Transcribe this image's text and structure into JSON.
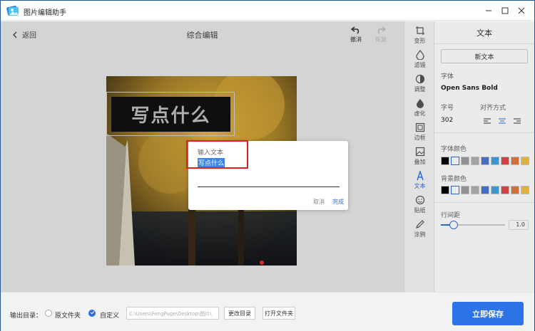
{
  "app": {
    "title": "图片编辑助手"
  },
  "header": {
    "back_label": "返回",
    "page_title": "综合编辑",
    "undo_label": "撤消",
    "redo_label": "恢复"
  },
  "canvas": {
    "overlay_text": "写点什么"
  },
  "dialog": {
    "title": "输入文本",
    "value": "写点什么",
    "cancel_label": "取消",
    "done_label": "完成"
  },
  "toolbar": {
    "items": [
      {
        "label": "变形",
        "icon": "crop-icon"
      },
      {
        "label": "滤镜",
        "icon": "filter-icon"
      },
      {
        "label": "调整",
        "icon": "adjust-icon"
      },
      {
        "label": "虚化",
        "icon": "blur-icon"
      },
      {
        "label": "边框",
        "icon": "frame-icon"
      },
      {
        "label": "叠加",
        "icon": "overlay-icon"
      },
      {
        "label": "文本",
        "icon": "text-icon"
      },
      {
        "label": "贴纸",
        "icon": "sticker-icon"
      },
      {
        "label": "涂鸦",
        "icon": "doodle-icon"
      }
    ],
    "active": "文本"
  },
  "panel": {
    "title": "文本",
    "new_text_label": "新文本",
    "font_label": "字体",
    "font_value": "Open Sans Bold",
    "size_label": "字号",
    "size_value": "302",
    "align_label": "对齐方式",
    "font_color_label": "字体颜色",
    "bg_color_label": "背景颜色",
    "line_spacing_label": "行间距",
    "line_spacing_value": "1.0",
    "line_spacing_level": 0.1,
    "font_colors": [
      "#000000",
      "#ffffff",
      "#9e9e9e",
      "#b0b0b0",
      "#4a78d6",
      "#3fa3e0",
      "#e04848",
      "#e07a3f",
      "#f0c040"
    ],
    "bg_colors": [
      "#000000",
      "#ffffff",
      "#9e9e9e",
      "#b0b0b0",
      "#4a78d6",
      "#3fa3e0",
      "#e04848",
      "#e07a3f",
      "#f0c040"
    ]
  },
  "bottom": {
    "output_label": "输出目录：",
    "option_original": "原文件夹",
    "option_custom": "自定义",
    "path_value": "C:\\Users\\FengPuge\\Desktop\\图片\\",
    "change_dir_label": "更改目录",
    "open_folder_label": "打开文件夹",
    "save_label": "立即保存"
  },
  "colors": {
    "accent": "#2b73e6",
    "highlight": "#e02020"
  }
}
